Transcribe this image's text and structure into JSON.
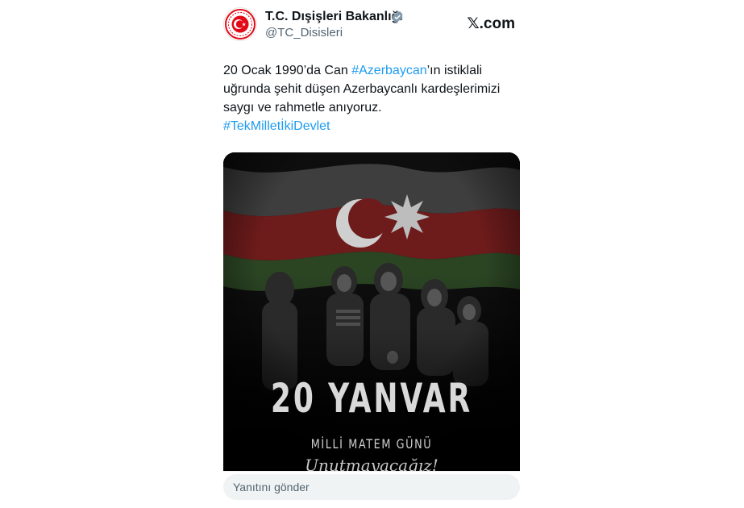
{
  "tweet": {
    "author": {
      "display_name": "T.C. Dışişleri Bakanlığı",
      "handle": "@TC_Disisleri",
      "verified": true,
      "avatar_icon": "turkish-ministry-seal-icon"
    },
    "brand": {
      "glyph": "𝕏",
      "label": ".com"
    },
    "text": {
      "part1": "20 Ocak 1990’da Can ",
      "hashtag1": "#Azerbaycan",
      "part2": "’ın istiklali uğrunda şehit düşen Azerbaycanlı kardeşlerimizi saygı ve rahmetle anıyoruz.",
      "hashtag2": "#TekMilletİkiDevlet"
    },
    "image": {
      "title": "20 YANVAR",
      "subtitle": "MİLLİ MATEM GÜNÜ",
      "script_text": "Unutmayacağız!",
      "flag_colors": [
        "#3a3a3a",
        "#7a1e1e",
        "#2d4a22"
      ]
    },
    "reply": {
      "placeholder": "Yanıtını gönder"
    },
    "colors": {
      "link": "#1d9bf0",
      "text": "#0f1419",
      "secondary": "#536471",
      "verified": "#829aab"
    }
  }
}
